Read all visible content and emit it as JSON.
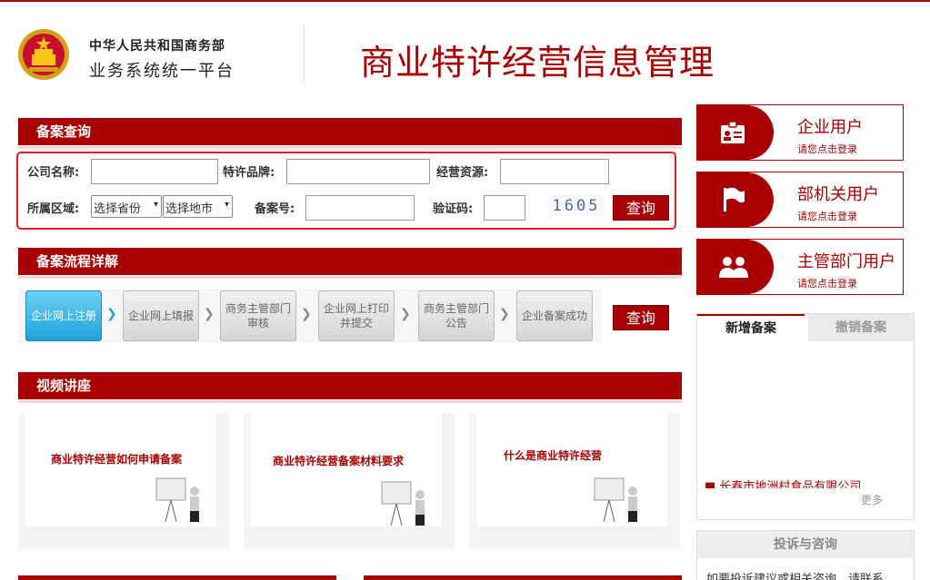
{
  "header": {
    "ministry": "中华人民共和国商务部",
    "platform": "业务系统统一平台",
    "title": "商业特许经营信息管理"
  },
  "filing_query": {
    "section_title": "备案查询",
    "company_name_label": "公司名称:",
    "brand_label": "特许品牌:",
    "resource_label": "经营资源:",
    "region_label": "所属区域:",
    "province_select": "选择省份",
    "city_select": "选择地市",
    "record_no_label": "备案号:",
    "captcha_label": "验证码:",
    "captcha_text": "1605",
    "query_button": "查询"
  },
  "process": {
    "section_title": "备案流程详解",
    "steps": [
      {
        "line1": "企业网上注册",
        "line2": ""
      },
      {
        "line1": "企业网上填报",
        "line2": ""
      },
      {
        "line1": "商务主管部门",
        "line2": "审核"
      },
      {
        "line1": "企业网上打印",
        "line2": "并提交"
      },
      {
        "line1": "商务主管部门",
        "line2": "公告"
      },
      {
        "line1": "企业备案成功",
        "line2": ""
      }
    ],
    "query_button": "查询"
  },
  "videos": {
    "section_title": "视频讲座",
    "items": [
      {
        "title": "商业特许经营如何申请备案"
      },
      {
        "title": "商业特许经营备案材料要求"
      },
      {
        "title": "什么是商业特许经营"
      }
    ]
  },
  "users": [
    {
      "title": "企业用户",
      "sub": "请您点击登录",
      "icon": "id-card-icon"
    },
    {
      "title": "部机关用户",
      "sub": "请您点击登录",
      "icon": "flag-icon"
    },
    {
      "title": "主管部门用户",
      "sub": "请您点击登录",
      "icon": "users-icon"
    }
  ],
  "filing_tabs": {
    "active": "新增备案",
    "inactive": "撤销备案",
    "list_item": "■ 长春市地洲村食品有限公司",
    "more": "更多"
  },
  "complaint": {
    "title": "投诉与咨询",
    "text": "如要投诉建议或相关咨询，请联系"
  },
  "colors": {
    "brand_red": "#a80000",
    "highlight_border": "#e02020",
    "active_step": "#1da2d8"
  }
}
